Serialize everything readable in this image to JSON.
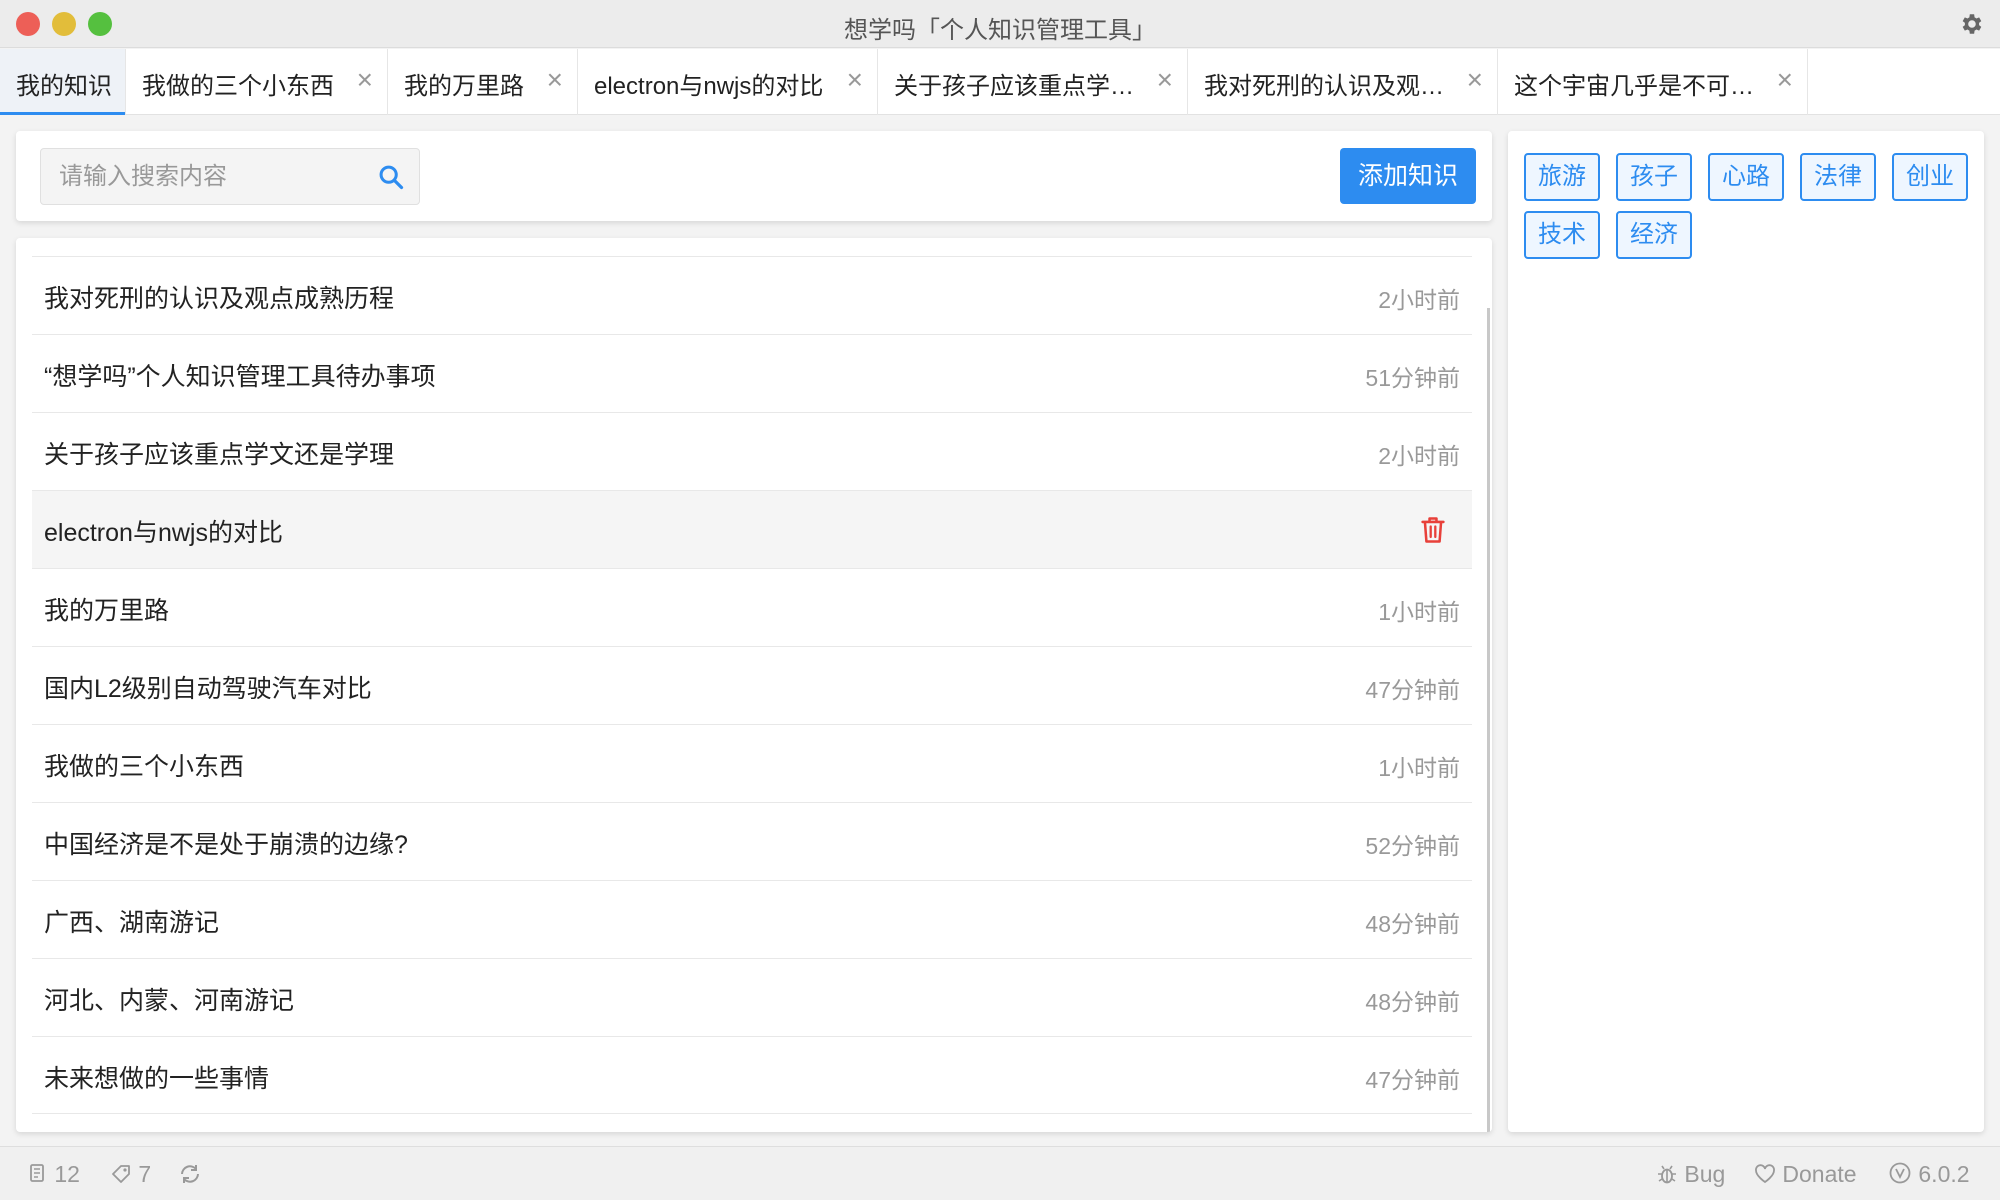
{
  "window": {
    "title": "想学吗「个人知识管理工具」"
  },
  "tabs": [
    {
      "label": "我的知识",
      "active": true,
      "closable": false
    },
    {
      "label": "我做的三个小东西",
      "active": false,
      "closable": true
    },
    {
      "label": "我的万里路",
      "active": false,
      "closable": true
    },
    {
      "label": "electron与nwjs的对比",
      "active": false,
      "closable": true
    },
    {
      "label": "关于孩子应该重点学…",
      "active": false,
      "closable": true
    },
    {
      "label": "我对死刑的认识及观…",
      "active": false,
      "closable": true
    },
    {
      "label": "这个宇宙几乎是不可…",
      "active": false,
      "closable": true
    }
  ],
  "tab_close_glyph": "×",
  "search": {
    "placeholder": "请输入搜索内容",
    "value": ""
  },
  "add_button": {
    "label": "添加知识"
  },
  "knowledge_list": [
    {
      "title": "我对死刑的认识及观点成熟历程",
      "time": "2小时前"
    },
    {
      "title": "“想学吗”个人知识管理工具待办事项",
      "time": "51分钟前"
    },
    {
      "title": "关于孩子应该重点学文还是学理",
      "time": "2小时前"
    },
    {
      "title": "electron与nwjs的对比",
      "time": "",
      "hovered": true
    },
    {
      "title": "我的万里路",
      "time": "1小时前"
    },
    {
      "title": "国内L2级别自动驾驶汽车对比",
      "time": "47分钟前"
    },
    {
      "title": "我做的三个小东西",
      "time": "1小时前"
    },
    {
      "title": "中国经济是不是处于崩溃的边缘?",
      "time": "52分钟前"
    },
    {
      "title": "广西、湖南游记",
      "time": "48分钟前"
    },
    {
      "title": "河北、内蒙、河南游记",
      "time": "48分钟前"
    },
    {
      "title": "未来想做的一些事情",
      "time": "47分钟前"
    }
  ],
  "tags": [
    "旅游",
    "孩子",
    "心路",
    "法律",
    "创业",
    "技术",
    "经济"
  ],
  "status": {
    "doc_count": "12",
    "tag_count": "7",
    "bug_label": "Bug",
    "donate_label": "Donate",
    "version": "6.0.2"
  },
  "colors": {
    "accent": "#2d8cf0",
    "delete": "#e8403a"
  },
  "icons": {
    "settings": "gear-icon",
    "search": "search-icon",
    "delete": "trash-icon",
    "docs": "document-icon",
    "tags": "tag-icon",
    "sync": "refresh-icon",
    "bug": "bug-icon",
    "donate": "heart-icon",
    "version": "version-icon"
  }
}
